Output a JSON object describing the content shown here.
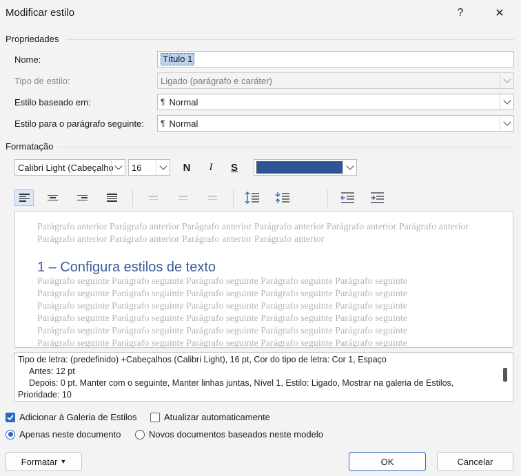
{
  "dialog": {
    "title": "Modificar estilo",
    "help": "?",
    "close": "✕"
  },
  "properties": {
    "section_label": "Propriedades",
    "name_label": "Nome:",
    "name_value": "Título 1",
    "style_type_label": "Tipo de estilo:",
    "style_type_value": "Ligado (parágrafo e caráter)",
    "based_on_label": "Estilo baseado em:",
    "based_on_value": "Normal",
    "next_style_label": "Estilo para o parágrafo seguinte:",
    "next_style_value": "Normal"
  },
  "formatting": {
    "section_label": "Formatação",
    "font": "Calibri Light (Cabeçalho",
    "size": "16",
    "bold": "N",
    "italic": "I",
    "underline": "S",
    "color": "#2f5597"
  },
  "preview": {
    "previous_text": "Parágrafo anterior Parágrafo anterior Parágrafo anterior Parágrafo anterior Parágrafo anterior Parágrafo anterior Parágrafo anterior Parágrafo anterior Parágrafo anterior Parágrafo anterior",
    "heading": "1 – Configura estilos de texto",
    "following_lines": [
      "Parágrafo seguinte Parágrafo seguinte Parágrafo seguinte Parágrafo seguinte Parágrafo seguinte",
      "Parágrafo seguinte Parágrafo seguinte Parágrafo seguinte Parágrafo seguinte Parágrafo seguinte",
      "Parágrafo seguinte Parágrafo seguinte Parágrafo seguinte Parágrafo seguinte Parágrafo seguinte",
      "Parágrafo seguinte Parágrafo seguinte Parágrafo seguinte Parágrafo seguinte Parágrafo seguinte",
      "Parágrafo seguinte Parágrafo seguinte Parágrafo seguinte Parágrafo seguinte Parágrafo seguinte",
      "Parágrafo seguinte Parágrafo seguinte Parágrafo seguinte Parágrafo seguinte Parágrafo seguinte"
    ]
  },
  "description": {
    "line1": "Tipo de letra: (predefinido) +Cabeçalhos (Calibri Light), 16 pt, Cor do tipo de letra: Cor 1, Espaço",
    "line2": "Antes:  12 pt",
    "line3": "Depois:  0 pt, Manter com o seguinte, Manter linhas juntas, Nível 1, Estilo: Ligado, Mostrar na galeria de Estilos,",
    "line4": "Prioridade: 10"
  },
  "options": {
    "add_gallery": "Adicionar à Galeria de Estilos",
    "auto_update": "Atualizar automaticamente",
    "only_doc": "Apenas neste documento",
    "new_docs": "Novos documentos baseados neste modelo"
  },
  "buttons": {
    "format": "Formatar",
    "ok": "OK",
    "cancel": "Cancelar"
  }
}
